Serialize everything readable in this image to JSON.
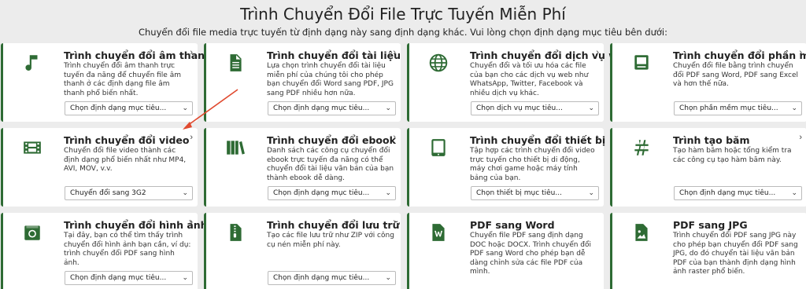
{
  "header": {
    "title": "Trình Chuyển Đổi File Trực Tuyến Miễn Phí",
    "subtitle": "Chuyển đổi file media trực tuyến từ định dạng này sang định dạng khác. Vui lòng chọn định dạng mục tiêu bên dưới:"
  },
  "accent_color": "#2e6b34",
  "annotation_color": "#e04a2f",
  "cards": [
    {
      "title": "Trình chuyển đổi âm thanh",
      "icon": "music-note-icon",
      "desc": "Trình chuyển đổi âm thanh trực tuyến đa năng để chuyển file âm thanh ở các định dạng file âm thanh phổ biến nhất.",
      "select": "Chọn định dạng mục tiêu..."
    },
    {
      "title": "Trình chuyển đổi tài liệu",
      "icon": "document-icon",
      "desc": "Lựa chọn trình chuyển đổi tài liệu miễn phí của chúng tôi cho phép bạn chuyển đổi Word sang PDF, JPG sang PDF nhiều hơn nữa.",
      "select": "Chọn định dạng mục tiêu..."
    },
    {
      "title": "Trình chuyển đổi dịch vụ web",
      "icon": "globe-icon",
      "desc": "Chuyển đổi và tối ưu hóa các file của bạn cho các dịch vụ web như WhatsApp, Twitter, Facebook và nhiều dịch vụ khác.",
      "select": "Chọn dịch vụ mục tiêu..."
    },
    {
      "title": "Trình chuyển đổi phần mềm",
      "icon": "computer-icon",
      "desc": "Chuyển đổi file bằng trình chuyển đổi PDF sang Word, PDF sang Excel và hơn thế nữa.",
      "select": "Chọn phần mềm mục tiêu..."
    },
    {
      "title": "Trình chuyển đổi video",
      "icon": "film-icon",
      "desc": "Chuyển đổi file video thành các định dạng phổ biến nhất như MP4, AVI, MOV, v.v.",
      "select": "Chuyển đổi sang 3G2"
    },
    {
      "title": "Trình chuyển đổi ebook",
      "icon": "books-icon",
      "desc": "Danh sách các công cụ chuyển đổi ebook trực tuyến đa năng có thể chuyển đổi tài liệu văn bản của bạn thành ebook dễ dàng.",
      "select": "Chọn định dạng mục tiêu..."
    },
    {
      "title": "Trình chuyển đổi thiết bị",
      "icon": "tablet-icon",
      "desc": "Tập hợp các trình chuyển đổi video trực tuyến cho thiết bị di động, máy chơi game hoặc máy tính bảng của bạn.",
      "select": "Chọn thiết bị mục tiêu..."
    },
    {
      "title": "Trình tạo băm",
      "icon": "hash-icon",
      "desc": "Tạo hàm băm hoặc tổng kiểm tra các công cụ tạo hàm băm này.",
      "select": "Chọn định dạng mục tiêu..."
    },
    {
      "title": "Trình chuyển đổi hình ảnh",
      "icon": "camera-icon",
      "desc": "Tại đây, bạn có thể tìm thấy trình chuyển đổi hình ảnh bạn cần, ví dụ: trình chuyển đổi PDF sang hình ảnh.",
      "select": "Chọn định dạng mục tiêu..."
    },
    {
      "title": "Trình chuyển đổi lưu trữ",
      "icon": "zip-file-icon",
      "desc": "Tạo các file lưu trữ như ZIP với công cụ nén miễn phí này.",
      "select": "Chọn định dạng mục tiêu..."
    },
    {
      "title": "PDF sang Word",
      "icon": "word-file-icon",
      "desc": "Chuyển file PDF sang định dạng DOC hoặc DOCX. Trình chuyển đổi PDF sang Word cho phép bạn dễ dàng chỉnh sửa các file PDF của mình.",
      "select": ""
    },
    {
      "title": "PDF sang JPG",
      "icon": "image-file-icon",
      "desc": "Trình chuyển đổi PDF sang JPG này cho phép bạn chuyển đổi PDF sang JPG, do đó chuyển tài liệu văn bản PDF của bạn thành định dạng hình ảnh raster phổ biến.",
      "select": ""
    }
  ]
}
